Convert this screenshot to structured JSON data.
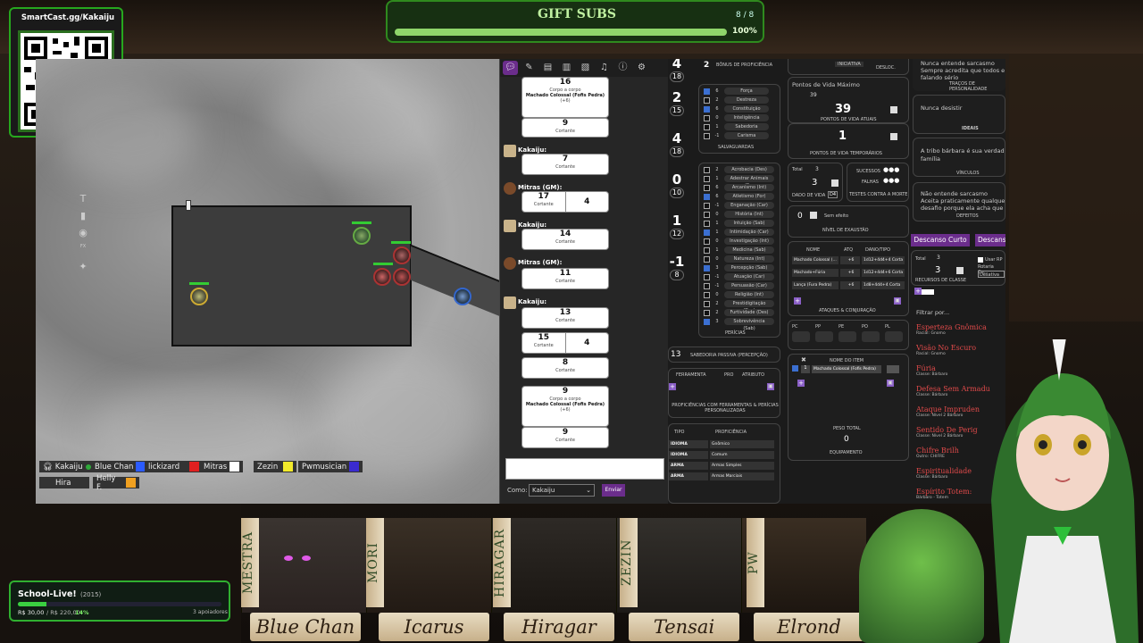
{
  "gift": {
    "title": "GIFT SUBS",
    "count": "8 / 8",
    "percent": "100%",
    "progress": 1.0
  },
  "qr": {
    "label": "SmartCast.gg/Kakaiju"
  },
  "players": [
    {
      "name": "Kakaiju",
      "color": "#2faa3a"
    },
    {
      "name": "Blue Chan",
      "color": "#2b5bff"
    },
    {
      "name": "lickizard",
      "color": "#e02020"
    },
    {
      "name": "Mitras",
      "color": "#ffffff"
    },
    {
      "name": "Zezin",
      "color": "#f2ea2a"
    },
    {
      "name": "Pwmusician",
      "color": "#3a2bd0"
    },
    {
      "name": "Hira",
      "color": ""
    },
    {
      "name": "Helly F.",
      "color": "#f0a020"
    }
  ],
  "map_tools": {
    "zoom": "62"
  },
  "chat": {
    "messages": [
      {
        "rolls": [
          {
            "value": "16",
            "lines": [
              "Corpo a corpo",
              "Machado Colossal (Fofis Pedra)",
              "(+6)"
            ]
          },
          {
            "value": "9",
            "lines": [
              "Cortante"
            ]
          }
        ]
      },
      {
        "sender": "Kakaiju:",
        "rolls": [
          {
            "value": "7",
            "lines": [
              "Cortante"
            ]
          }
        ]
      },
      {
        "sender": "Mitras (GM):",
        "split": {
          "a": "17",
          "a_label": "Cortante",
          "b": "4"
        }
      },
      {
        "sender": "Kakaiju:",
        "rolls": [
          {
            "value": "14",
            "lines": [
              "Cortante"
            ]
          }
        ]
      },
      {
        "sender": "Mitras (GM):",
        "rolls": [
          {
            "value": "11",
            "lines": [
              "Cortante"
            ]
          }
        ]
      },
      {
        "sender": "Kakaiju:",
        "rolls": [
          {
            "value": "13",
            "lines": [
              "Cortante"
            ]
          }
        ],
        "split": {
          "a": "15",
          "a_label": "Cortante",
          "b": "4"
        },
        "rolls2": [
          {
            "value": "8",
            "lines": [
              "Cortante"
            ]
          },
          {
            "value": "9",
            "lines": [
              "Corpo a corpo",
              "Machado Colossal (Fofis Pedra)",
              "(+6)"
            ]
          },
          {
            "value": "9",
            "lines": [
              "Cortante"
            ]
          }
        ]
      }
    ],
    "as_label": "Como:",
    "as_value": "Kakaiju",
    "send": "Enviar"
  },
  "sheet": {
    "abilities": [
      {
        "mod": "4",
        "score": "18"
      },
      {
        "mod": "2",
        "score": "15",
        "label": "DESTREZA"
      },
      {
        "mod": "4",
        "score": "18",
        "label": "CONSTITUIÇÃO"
      },
      {
        "mod": "0",
        "score": "10",
        "label": "INTELIGÊNCIA"
      },
      {
        "mod": "1",
        "score": "12",
        "label": "SABEDORIA"
      },
      {
        "mod": "-1",
        "score": "8",
        "label": "CARISMA"
      }
    ],
    "prof_bonus": "2",
    "prof_label": "BÔNUS DE PROFICIÊNCIA",
    "saves": [
      {
        "v": "6",
        "n": "Força",
        "on": true
      },
      {
        "v": "2",
        "n": "Destreza",
        "on": false
      },
      {
        "v": "6",
        "n": "Constituição",
        "on": true
      },
      {
        "v": "0",
        "n": "Inteligência",
        "on": false
      },
      {
        "v": "1",
        "n": "Sabedoria",
        "on": false
      },
      {
        "v": "-1",
        "n": "Carisma",
        "on": false
      }
    ],
    "saves_label": "SALVAGUARDAS",
    "skills": [
      {
        "v": "2",
        "n": "Acrobacia (Des)",
        "on": false
      },
      {
        "v": "1",
        "n": "Adestrar Animais (S...",
        "on": false
      },
      {
        "v": "6",
        "n": "Arcanismo (Int)",
        "on": false
      },
      {
        "v": "6",
        "n": "Atletismo (For)",
        "on": true
      },
      {
        "v": "-1",
        "n": "Enganação (Car)",
        "on": false
      },
      {
        "v": "0",
        "n": "História (Int)",
        "on": false
      },
      {
        "v": "1",
        "n": "Intuição (Sab)",
        "on": false
      },
      {
        "v": "1",
        "n": "Intimidação (Car)",
        "on": true
      },
      {
        "v": "0",
        "n": "Investigação (Int)",
        "on": false
      },
      {
        "v": "1",
        "n": "Medicina (Sab)",
        "on": false
      },
      {
        "v": "0",
        "n": "Natureza (Int)",
        "on": false
      },
      {
        "v": "3",
        "n": "Percepção (Sab)",
        "on": true
      },
      {
        "v": "-1",
        "n": "Atuação (Car)",
        "on": false
      },
      {
        "v": "-1",
        "n": "Persuasão (Car)",
        "on": false
      },
      {
        "v": "0",
        "n": "Religião (Int)",
        "on": false
      },
      {
        "v": "2",
        "n": "Prestidigitação (Des)",
        "on": false
      },
      {
        "v": "2",
        "n": "Furtividade (Des)",
        "on": false
      },
      {
        "v": "3",
        "n": "Sobrevivência (Sab)",
        "on": true
      }
    ],
    "skills_label": "PERÍCIAS",
    "passive": "13",
    "passive_label": "SABEDORIA PASSIVA (PERCEPÇÃO)",
    "tools_cols": [
      "FERRAMENTA",
      "PRO",
      "ATRIBUTO"
    ],
    "tools_label": "PROFICIÊNCIAS COM FERRAMENTAS & PERÍCIAS PERSONALIZADAS",
    "prof_cols": [
      "TIPO",
      "PROFICIÊNCIA"
    ],
    "profs": [
      {
        "t": "IDIOMA",
        "p": "Gnômico"
      },
      {
        "t": "IDIOMA",
        "p": "Comum"
      },
      {
        "t": "ARMA",
        "p": "Armas Simples"
      },
      {
        "t": "ARMA",
        "p": "Armas Marciais"
      }
    ],
    "initiative": "INICIATIVA",
    "speed": "DESLOC.",
    "hp_max_label": "Pontos de Vida Máximo",
    "hp_max": "39",
    "hp_current": "39",
    "hp_current_label": "PONTOS DE VIDA ATUAIS",
    "hp_temp": "1",
    "hp_temp_label": "PONTOS DE VIDA TEMPORÁRIOS",
    "hd_total_label": "Total",
    "hd_total": "3",
    "hd": "3",
    "hd_label": "DADO DE VIDA",
    "hd_die": "D4",
    "death_success": "SUCESSOS",
    "death_fail": "FALHAS",
    "death_label": "TESTES CONTRA A MORTE",
    "exhaust": "0",
    "exhaust_opt": "Sem efeito",
    "exhaust_label": "NÍVEL DE EXAUSTÃO",
    "atk_cols": [
      "NOME",
      "ATQ",
      "DANO/TIPO"
    ],
    "attacks": [
      {
        "n": "Machado Colossal (...",
        "a": "+6",
        "d": "1d12+4d4+4 Corta"
      },
      {
        "n": "Machado+Fúria",
        "a": "+6",
        "d": "1d12+4d4+6 Corta"
      },
      {
        "n": "Lança (Fura Pedra)",
        "a": "+6",
        "d": "1d8+4d4+4 Corta"
      }
    ],
    "atk_label": "ATAQUES & CONJURAÇÃO",
    "coins": [
      "PC",
      "PP",
      "PE",
      "PO",
      "PL"
    ],
    "item_label": "NOME DO ITEM",
    "item": "Machado Colossal (Fofis Pedra)",
    "item_qty": "1",
    "weight_label": "PESO TOTAL",
    "weight": "0",
    "equip_label": "EQUIPAMENTO",
    "traits": [
      "Nunca entende sarcasmo",
      "Sempre acredita que todos e",
      "falando sério"
    ],
    "traits_label": "TRAÇOS DE PERSONALIDADE",
    "ideal": "Nunca desistir",
    "ideal_label": "IDEAIS",
    "bond": "A tribo bárbara é sua verdad família",
    "bond_label": "VÍNCULOS",
    "flaws": [
      "Não entende sarcasmo",
      "Aceita praticamente qualque",
      "desafio porque ela acha que"
    ],
    "flaws_label": "DEFEITOS",
    "rest_short": "Descanso Curto",
    "rest_long": "Descans",
    "cls_total_label": "Total",
    "cls_total": "3",
    "cls": "3",
    "cls_label": "RECURSOS DE CLASSE",
    "cls_opt1": "Usar RP",
    "cls_opt2": "Rotaria Cu...",
    "cls_opt3": "Desativa",
    "filter": "Filtrar por...",
    "features": [
      {
        "t": "Esperteza Gnômica",
        "s": "Racial: Gnomo"
      },
      {
        "t": "Visão No Escuro",
        "s": "Racial: Gnomo"
      },
      {
        "t": "Fúria",
        "s": "Classe: Bárbaro"
      },
      {
        "t": "Defesa Sem Armadu",
        "s": "Classe: Bárbaro"
      },
      {
        "t": "Ataque Impruden",
        "s": "Classe: Nível 2 Bárbaro"
      },
      {
        "t": "Sentido De Perig",
        "s": "Classe: Nível 2 Bárbaro"
      },
      {
        "t": "Chifre Brilh",
        "s": "Outro: CHIFRE"
      },
      {
        "t": "Espiritualidade",
        "s": "Classe: Bárbaro"
      },
      {
        "t": "Espírito Totem:",
        "s": "Bárbaro - Totem"
      }
    ]
  },
  "school": {
    "title": "School-Live!",
    "year": "(2015)",
    "raised": "R$ 30,00",
    "goal": "/ R$ 220,00",
    "pct": "14%",
    "supporters": "3 apoiadores",
    "progress": 0.14
  },
  "cast": [
    {
      "vname": "MESTRA",
      "plate": "Blue Chan"
    },
    {
      "vname": "MORI",
      "plate": "Icarus"
    },
    {
      "vname": "HIRAGAR",
      "plate": "Hiragar"
    },
    {
      "vname": "ZEZIN",
      "plate": "Tensai"
    },
    {
      "vname": "PW",
      "plate": "Elrond"
    }
  ]
}
